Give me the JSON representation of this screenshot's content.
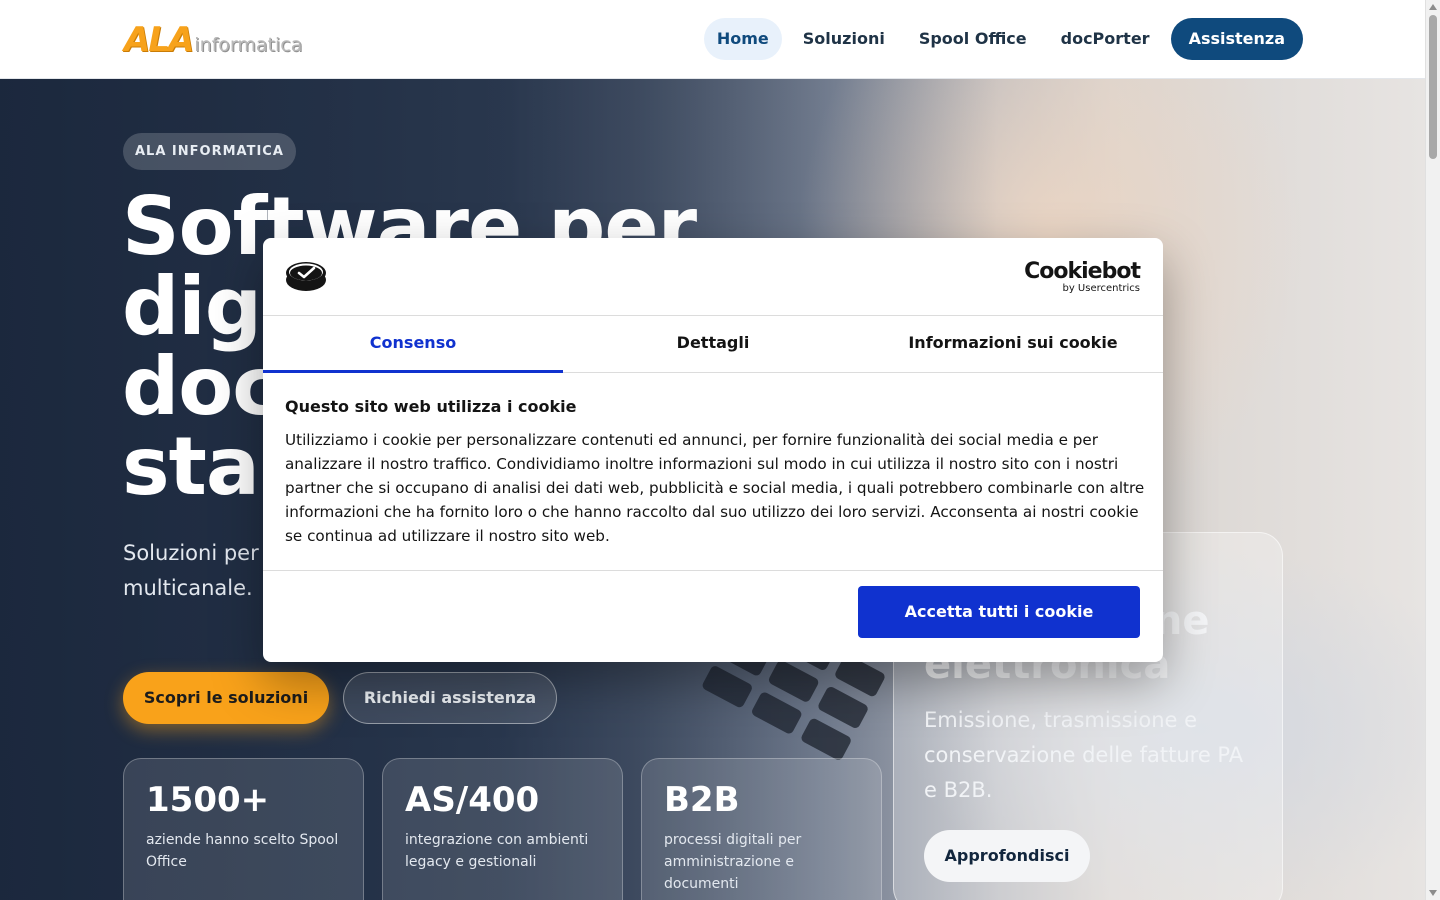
{
  "header": {
    "logo_ala": "ALA",
    "logo_informatica": "informatica",
    "nav": [
      "Home",
      "Soluzioni",
      "Spool Office",
      "docPorter"
    ],
    "nav_cta": "Assistenza"
  },
  "hero": {
    "badge": "ALA INFORMATICA",
    "title": "Software per digitalizzare documenti e stampe",
    "subtitle": "Soluzioni per gestione documentale, stampe e spedizione multicanale.",
    "primary_btn": "Scopri le soluzioni",
    "secondary_btn": "Richiedi assistenza",
    "stats": [
      {
        "value": "1500+",
        "desc": "aziende hanno scelto Spool Office"
      },
      {
        "value": "AS/400",
        "desc": "integrazione con ambienti legacy e gestionali"
      },
      {
        "value": "B2B",
        "desc": "processi digitali per amministrazione e documenti"
      }
    ],
    "card": {
      "title": "Fatturazione elettronica",
      "desc": "Emissione, trasmissione e conservazione delle fatture PA e B2B.",
      "button": "Approfondisci"
    }
  },
  "cookie_dialog": {
    "brand": "Cookiebot",
    "brand_sub": "by Usercentrics",
    "tabs": [
      "Consenso",
      "Dettagli",
      "Informazioni sui cookie"
    ],
    "active_tab": "Consenso",
    "title": "Questo sito web utilizza i cookie",
    "text": "Utilizziamo i cookie per personalizzare contenuti ed annunci, per fornire funzionalità dei social media e per analizzare il nostro traffico. Condividiamo inoltre informazioni sul modo in cui utilizza il nostro sito con i nostri partner che si occupano di analisi dei dati web, pubblicità e social media, i quali potrebbero combinarle con altre informazioni che ha fornito loro o che hanno raccolto dal suo utilizzo dei loro servizi. Acconsenta ai nostri cookie se continua ad utilizzare il nostro sito web.",
    "accept_button": "Accetta tutti i cookie"
  },
  "colors": {
    "brand_orange": "#f9a21a",
    "brand_navy": "#0f4a7d",
    "cookiebot_blue": "#1032cf"
  }
}
